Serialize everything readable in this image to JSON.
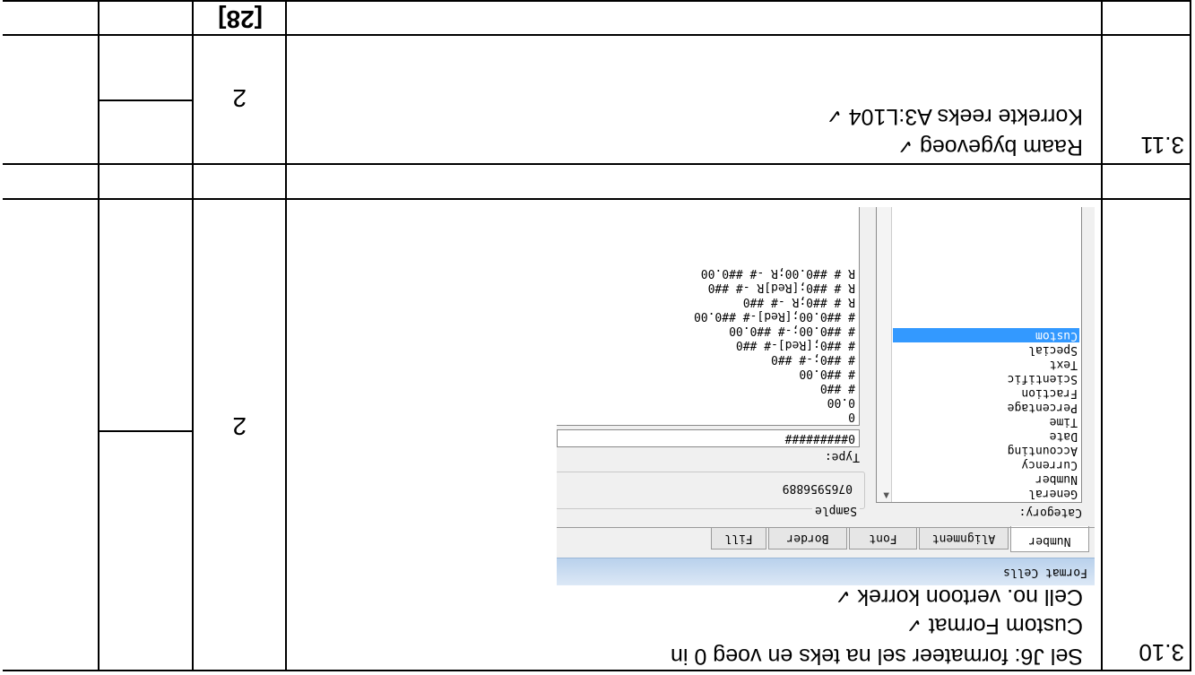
{
  "rows": [
    {
      "question": "3.10",
      "lines": [
        "Sel J6: formateer sel na teks en voeg 0 in",
        "Custom Format",
        "Cell no. vertoon korrek"
      ],
      "ticks": [
        "",
        "✓",
        "✓"
      ],
      "mark": "2"
    },
    {
      "question": "3.11",
      "lines": [
        "Raam bygevoeg",
        "Korrekte reeks A3:L104"
      ],
      "ticks": [
        "✓",
        "✓"
      ],
      "mark": "2"
    }
  ],
  "total": "[28]",
  "dialog": {
    "title": "Format Cells",
    "tabs": [
      "Number",
      "Alignment",
      "Font",
      "Border",
      "Fill"
    ],
    "category_label": "Category:",
    "categories": [
      "General",
      "Number",
      "Currency",
      "Accounting",
      "Date",
      "Time",
      "Percentage",
      "Fraction",
      "Scientific",
      "Text",
      "Special",
      "Custom"
    ],
    "selected_category": "Custom",
    "sample_label": "Sample",
    "sample_value": "0765956889",
    "type_label": "Type:",
    "type_value": "0#########",
    "formats": [
      "0",
      "0.00",
      "# ##0",
      "# ##0.00",
      "# ##0;-# ##0",
      "# ##0;[Red]-# ##0",
      "# ##0.00;-# ##0.00",
      "# ##0.00;[Red]-# ##0.00",
      "R # ##0;R -# ##0",
      "R # ##0;[Red]R -# ##0",
      "R # ##0.00;R -# ##0.00"
    ]
  }
}
